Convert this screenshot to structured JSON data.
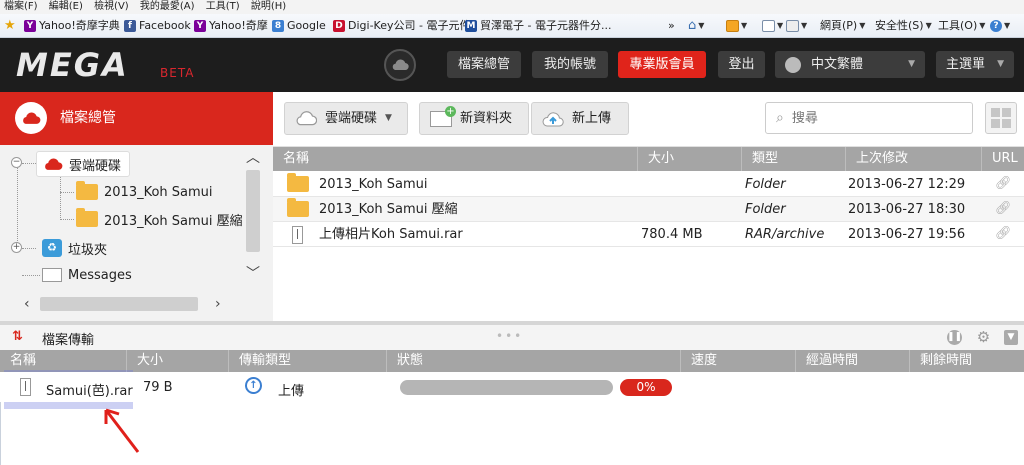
{
  "ie_menu": [
    "檔案(F)",
    "編輯(E)",
    "檢視(V)",
    "我的最愛(A)",
    "工具(T)",
    "說明(H)"
  ],
  "favorites": [
    {
      "label": "Yahoo!奇摩字典",
      "icon": "yahoo-icon",
      "color": "#7b0099"
    },
    {
      "label": "Facebook",
      "icon": "facebook-icon",
      "color": "#3b5998"
    },
    {
      "label": "Yahoo!奇摩",
      "icon": "yahoo-icon",
      "color": "#7b0099"
    },
    {
      "label": "Google",
      "icon": "google-icon",
      "color": "#3b7fd1"
    },
    {
      "label": "Digi-Key公司 - 電子元件",
      "icon": "digikey-icon",
      "color": "#c8102e"
    },
    {
      "label": "貿澤電子 - 電子元器件分...",
      "icon": "mouser-icon",
      "color": "#1f4e9c"
    }
  ],
  "ie_commands": {
    "page": "網頁(P)",
    "safety": "安全性(S)",
    "tools": "工具(O)"
  },
  "header": {
    "logo": "MEGA",
    "beta": "BETA",
    "file_manager": "檔案總管",
    "my_account": "我的帳號",
    "pro": "專業版會員",
    "logout": "登出",
    "language": "中文繁體",
    "main_menu": "主選單"
  },
  "sidebar": {
    "title": "檔案總管",
    "tree": [
      {
        "label": "雲端硬碟",
        "type": "root"
      },
      {
        "label": "2013_Koh Samui",
        "type": "folder"
      },
      {
        "label": "2013_Koh Samui 壓縮",
        "type": "folder"
      },
      {
        "label": "垃圾夾",
        "type": "trash"
      },
      {
        "label": "Messages",
        "type": "messages"
      }
    ]
  },
  "toolbar": {
    "cloud_drive": "雲端硬碟",
    "new_folder": "新資料夾",
    "upload": "新上傳",
    "search_placeholder": "搜尋"
  },
  "file_table": {
    "columns": [
      "名稱",
      "大小",
      "類型",
      "上次修改",
      "URL"
    ],
    "rows": [
      {
        "name": "2013_Koh Samui",
        "size": "",
        "type": "Folder",
        "modified": "2013-06-27 12:29",
        "icon": "folder-icon"
      },
      {
        "name": "2013_Koh Samui 壓縮",
        "size": "",
        "type": "Folder",
        "modified": "2013-06-27 18:30",
        "icon": "folder-icon"
      },
      {
        "name": "上傳相片Koh Samui.rar",
        "size": "780.4 MB",
        "type": "RAR/archive",
        "modified": "2013-06-27 19:56",
        "icon": "file-icon"
      }
    ]
  },
  "transfers": {
    "title": "檔案傳輸",
    "columns": [
      "名稱",
      "大小",
      "傳輸類型",
      "狀態",
      "速度",
      "經過時間",
      "剩餘時間"
    ],
    "rows": [
      {
        "name": "Samui(芭).rar",
        "size": "79 B",
        "transfer_type": "上傳",
        "progress": 0,
        "percent_label": "0%"
      }
    ]
  },
  "colors": {
    "brand_red": "#d9271d",
    "header_bg": "#1d1d1d",
    "table_head": "#a5a5a5",
    "folder": "#f4b941"
  }
}
